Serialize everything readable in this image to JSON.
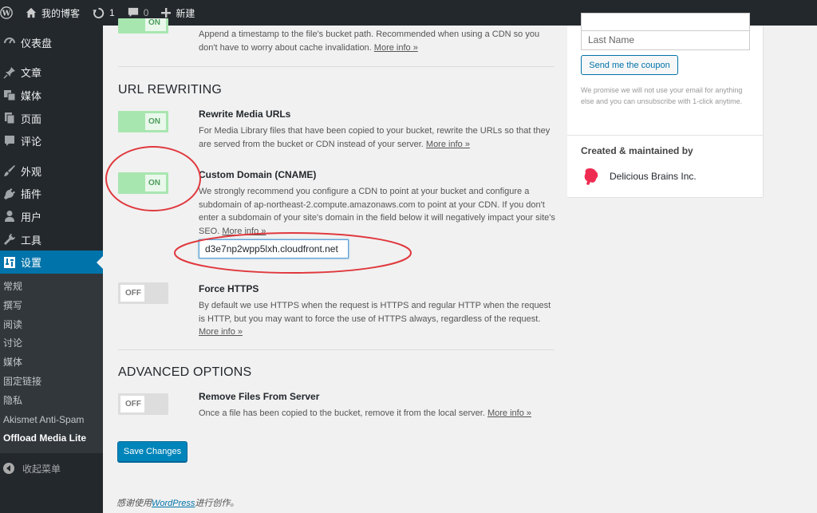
{
  "adminbar": {
    "site_name": "我的博客",
    "updates_count": "1",
    "comments_count": "0",
    "new_label": "新建"
  },
  "sidebar": {
    "items": [
      {
        "label": "仪表盘",
        "icon": "dashboard-icon"
      },
      {
        "label": "文章",
        "icon": "pin-icon"
      },
      {
        "label": "媒体",
        "icon": "media-icon"
      },
      {
        "label": "页面",
        "icon": "page-icon"
      },
      {
        "label": "评论",
        "icon": "comment-icon"
      },
      {
        "label": "外观",
        "icon": "brush-icon"
      },
      {
        "label": "插件",
        "icon": "plugin-icon"
      },
      {
        "label": "用户",
        "icon": "user-icon"
      },
      {
        "label": "工具",
        "icon": "wrench-icon"
      },
      {
        "label": "设置",
        "icon": "settings-icon"
      }
    ],
    "submenu": [
      "常规",
      "撰写",
      "阅读",
      "讨论",
      "媒体",
      "固定链接",
      "隐私",
      "Akismet Anti-Spam",
      "Offload Media Lite"
    ],
    "collapse_label": "收起菜单"
  },
  "top_setting": {
    "toggle": "ON",
    "desc": "Append a timestamp to the file's bucket path. Recommended when using a CDN so you don't have to worry about cache invalidation.",
    "more": "More info »"
  },
  "url_rewriting": {
    "title": "URL REWRITING",
    "rewrite": {
      "toggle": "ON",
      "title": "Rewrite Media URLs",
      "desc": "For Media Library files that have been copied to your bucket, rewrite the URLs so that they are served from the bucket or CDN instead of your server.",
      "more": "More info »"
    },
    "cname": {
      "toggle": "ON",
      "title": "Custom Domain (CNAME)",
      "desc": "We strongly recommend you configure a CDN to point at your bucket and configure a subdomain of ap-northeast-2.compute.amazonaws.com to point at your CDN. If you don't enter a subdomain of your site's domain in the field below it will negatively impact your site's SEO.",
      "more": "More info »",
      "value": "d3e7np2wpp5lxh.cloudfront.net"
    },
    "https": {
      "toggle": "OFF",
      "title": "Force HTTPS",
      "desc": "By default we use HTTPS when the request is HTTPS and regular HTTP when the request is HTTP, but you may want to force the use of HTTPS always, regardless of the request.",
      "more": "More info »"
    }
  },
  "advanced": {
    "title": "ADVANCED OPTIONS",
    "remove": {
      "toggle": "OFF",
      "title": "Remove Files From Server",
      "desc": "Once a file has been copied to the bucket, remove it from the local server.",
      "more": "More info »"
    }
  },
  "save_label": "Save Changes",
  "footer": {
    "pre": "感谢使用",
    "link": "WordPress",
    "post": "进行创作。"
  },
  "panel": {
    "last_name_placeholder": "Last Name",
    "coupon_button": "Send me the coupon",
    "promise": "We promise we will not use your email for anything else and you can unsubscribe with 1-click anytime.",
    "maintained_title": "Created & maintained by",
    "company": "Delicious Brains Inc."
  },
  "colors": {
    "admin_dark": "#23282d",
    "accent_blue": "#0073aa",
    "toggle_on": "#a8e6b0",
    "annotation_red": "#e0393e"
  }
}
